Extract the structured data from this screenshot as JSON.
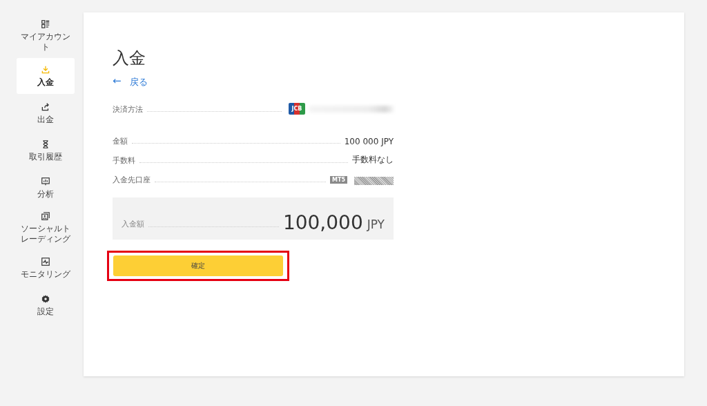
{
  "sidebar": {
    "items": [
      {
        "label": "マイアカウント",
        "selected": false
      },
      {
        "label": "入金",
        "selected": true
      },
      {
        "label": "出金",
        "selected": false
      },
      {
        "label": "取引履歴",
        "selected": false
      },
      {
        "label": "分析",
        "selected": false
      },
      {
        "label": "ソーシャルトレーディング",
        "selected": false
      },
      {
        "label": "モニタリング",
        "selected": false
      },
      {
        "label": "設定",
        "selected": false
      }
    ]
  },
  "page": {
    "title": "入金",
    "back_link": {
      "arrow": "←",
      "label": "戻る"
    }
  },
  "payment_method": {
    "label": "決済方法",
    "card_brand": "JCB"
  },
  "details": [
    {
      "kind": "text",
      "label": "金額",
      "value": "100 000 JPY"
    },
    {
      "kind": "text",
      "label": "手数料",
      "value": "手数料なし"
    },
    {
      "kind": "account",
      "label": "入金先口座",
      "badge": "MT5"
    }
  ],
  "total": {
    "label": "入金額",
    "amount": "100,000",
    "currency": "JPY"
  },
  "confirm_button": {
    "label": "確定",
    "highlighted": true
  }
}
